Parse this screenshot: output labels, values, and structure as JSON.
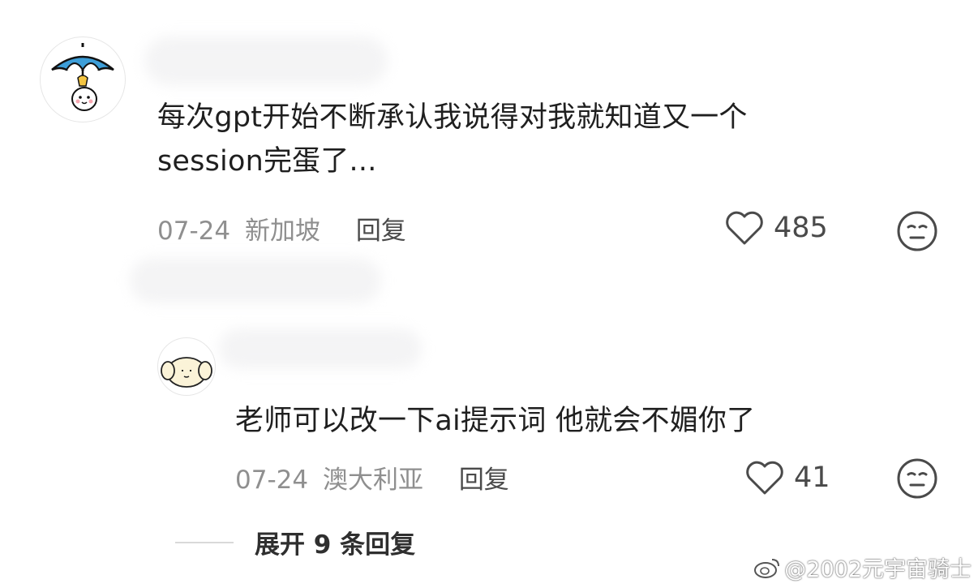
{
  "comment1": {
    "text_line1": "每次gpt开始不断承认我说得对我就知道又一个",
    "text_line2": "session完蛋了...",
    "date": "07-24",
    "location": "新加坡",
    "reply_label": "回复",
    "likes": "485",
    "avatar_icon": "umbrella-character-icon"
  },
  "comment2": {
    "text": "老师可以改一下ai提示词 他就会不媚你了",
    "date": "07-24",
    "location": "澳大利亚",
    "reply_label": "回复",
    "likes": "41",
    "avatar_icon": "puppy-character-icon"
  },
  "expand_label": "展开 9 条回复",
  "watermark": "@2002元宇宙骑士",
  "icons": {
    "like": "heart-outline-icon",
    "reaction": "neutral-face-icon",
    "watermark": "weibo-icon"
  }
}
